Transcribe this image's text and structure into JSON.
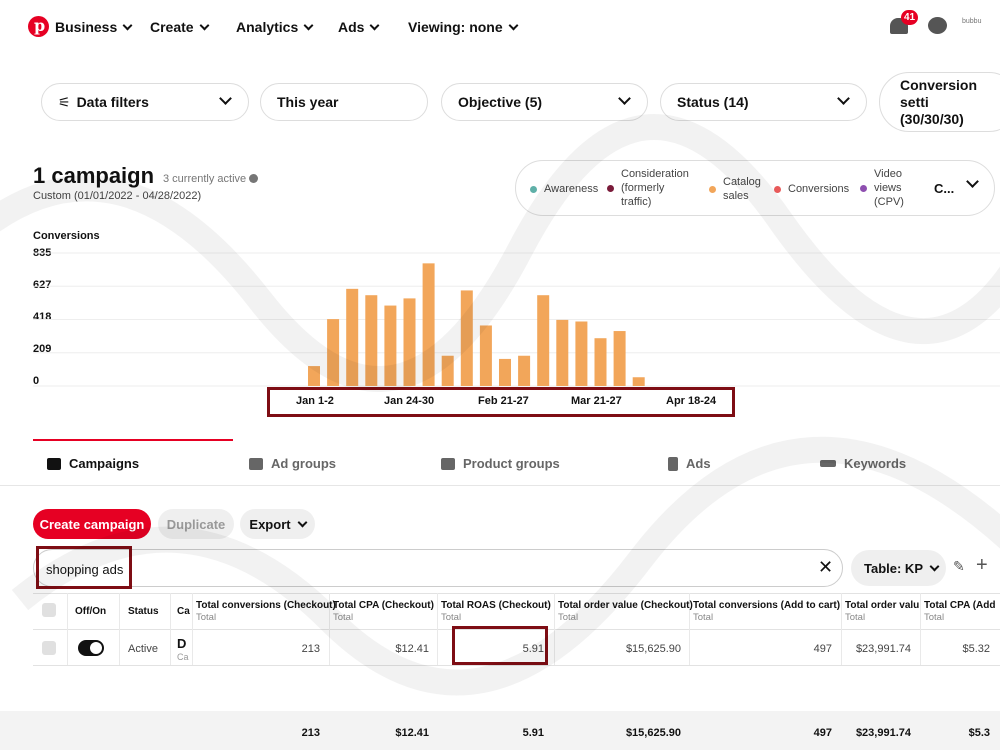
{
  "nav": {
    "business": "Business",
    "create": "Create",
    "analytics": "Analytics",
    "ads": "Ads",
    "viewing": "Viewing: none",
    "notifications_count": "41",
    "avatar_text": "bubbu"
  },
  "filters": {
    "data_filters": "Data filters",
    "date": "This year",
    "objective": "Objective (5)",
    "status": "Status (14)",
    "conversion_settings_line1": "Conversion setti",
    "conversion_settings_line2": "(30/30/30)"
  },
  "summary": {
    "title": "1 campaign",
    "active_note": "3 currently active",
    "date_range": "Custom (01/01/2022 - 04/28/2022)"
  },
  "legend": {
    "items": [
      {
        "label": "Awareness",
        "color": "#5fb0a8"
      },
      {
        "label": "Consideration (formerly traffic)",
        "color": "#7a1b3a"
      },
      {
        "label": "Catalog sales",
        "color": "#f2a65a"
      },
      {
        "label": "Conversions",
        "color": "#e85a5a"
      },
      {
        "label": "Video views (CPV)",
        "color": "#8e4fb0"
      }
    ],
    "more": "C..."
  },
  "chart_data": {
    "type": "bar",
    "ylabel": "Conversions",
    "yticks": [
      "835",
      "627",
      "418",
      "209",
      "0"
    ],
    "ylim": [
      0,
      835
    ],
    "xtick_labels": [
      "Jan 1-2",
      "Jan 24-30",
      "Feb 21-27",
      "Mar 21-27",
      "Apr 18-24"
    ],
    "bar_color": "#f2a65a",
    "values": [
      125,
      420,
      610,
      570,
      505,
      550,
      770,
      190,
      600,
      380,
      170,
      190,
      570,
      415,
      405,
      300,
      345,
      55
    ]
  },
  "tabs": [
    {
      "label": "Campaigns",
      "icon": "megaphone-icon"
    },
    {
      "label": "Ad groups",
      "icon": "ad-groups-icon"
    },
    {
      "label": "Product groups",
      "icon": "grid-icon"
    },
    {
      "label": "Ads",
      "icon": "phone-icon"
    },
    {
      "label": "Keywords",
      "icon": "key-icon"
    }
  ],
  "actions": {
    "create": "Create campaign",
    "duplicate": "Duplicate",
    "export": "Export"
  },
  "search": {
    "value": "shopping ads",
    "table_view": "Table: KP"
  },
  "table": {
    "headers": [
      {
        "label": "Off/On",
        "sub": ""
      },
      {
        "label": "Status",
        "sub": ""
      },
      {
        "label": "Ca",
        "sub": ""
      },
      {
        "label": "Total conversions (Checkout)",
        "sub": "Total"
      },
      {
        "label": "Total CPA (Checkout)",
        "sub": "Total"
      },
      {
        "label": "Total ROAS (Checkout)",
        "sub": "Total"
      },
      {
        "label": "Total order value (Checkout)",
        "sub": "Total"
      },
      {
        "label": "Total conversions (Add to cart)",
        "sub": "Total"
      },
      {
        "label": "Total order valu",
        "sub": "Total"
      },
      {
        "label": "Total CPA (Add",
        "sub": "Total"
      }
    ],
    "row": {
      "status": "Active",
      "campaign_initial": "D",
      "campaign_sub": "Ca",
      "conversions": "213",
      "cpa": "$12.41",
      "roas": "5.91",
      "order_value": "$15,625.90",
      "atc_conversions": "497",
      "atc_order_value": "$23,991.74",
      "atc_cpa": "$5.32"
    },
    "totals": {
      "conversions": "213",
      "cpa": "$12.41",
      "roas": "5.91",
      "order_value": "$15,625.90",
      "atc_conversions": "497",
      "atc_order_value": "$23,991.74",
      "atc_cpa": "$5.3"
    }
  }
}
